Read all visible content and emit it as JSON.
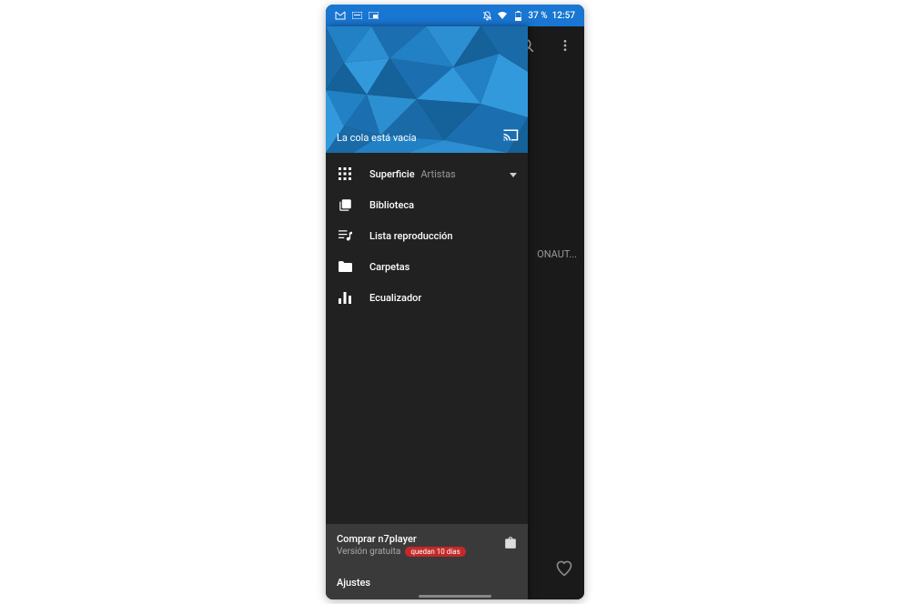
{
  "statusbar": {
    "battery": "37 %",
    "time": "12:57"
  },
  "main": {
    "behind_text": "ONAUT..."
  },
  "drawer": {
    "queue_status": "La cola está vacía",
    "items": [
      {
        "label": "Superficie",
        "sublabel": "Artistas",
        "has_chevron": true
      },
      {
        "label": "Biblioteca"
      },
      {
        "label": "Lista reproducción"
      },
      {
        "label": "Carpetas"
      },
      {
        "label": "Ecualizador"
      }
    ],
    "purchase": {
      "title": "Comprar n7player",
      "version_text": "Versión gratuita",
      "badge": "quedan 10 días"
    },
    "settings": "Ajustes"
  }
}
